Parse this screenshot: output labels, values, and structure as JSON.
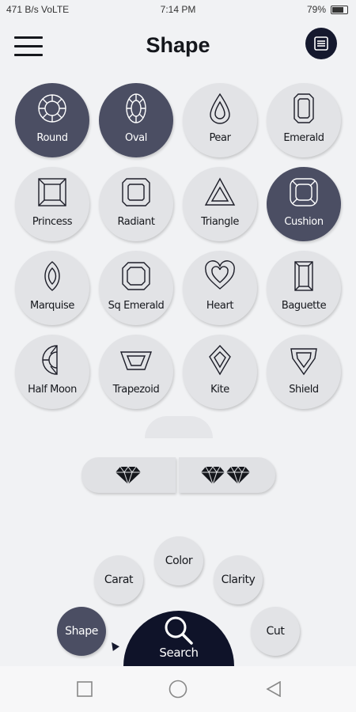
{
  "status": {
    "left": "471 B/s VoLTE",
    "time": "7:14 PM",
    "battery": "79%"
  },
  "header": {
    "title": "Shape",
    "menu_icon": "hamburger-menu-icon",
    "list_icon": "list-view-icon"
  },
  "shapes": [
    {
      "label": "Round",
      "selected": true
    },
    {
      "label": "Oval",
      "selected": true
    },
    {
      "label": "Pear",
      "selected": false
    },
    {
      "label": "Emerald",
      "selected": false
    },
    {
      "label": "Princess",
      "selected": false
    },
    {
      "label": "Radiant",
      "selected": false
    },
    {
      "label": "Triangle",
      "selected": false
    },
    {
      "label": "Cushion",
      "selected": true
    },
    {
      "label": "Marquise",
      "selected": false
    },
    {
      "label": "Sq Emerald",
      "selected": false
    },
    {
      "label": "Heart",
      "selected": false
    },
    {
      "label": "Baguette",
      "selected": false
    },
    {
      "label": "Half Moon",
      "selected": false
    },
    {
      "label": "Trapezoid",
      "selected": false
    },
    {
      "label": "Kite",
      "selected": false
    },
    {
      "label": "Shield",
      "selected": false
    }
  ],
  "toggle": {
    "single_icon": "diamond-icon",
    "multi_icon": "two-diamonds-icon"
  },
  "filters": {
    "shape": "Shape",
    "carat": "Carat",
    "color": "Color",
    "clarity": "Clarity",
    "cut": "Cut",
    "search": "Search"
  },
  "colors": {
    "selected": "#4b4e63",
    "unselected": "#e2e3e6",
    "accent": "#0f1329"
  }
}
